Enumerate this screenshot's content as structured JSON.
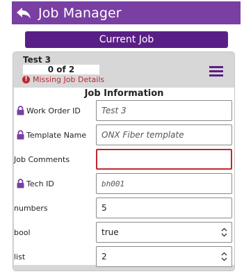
{
  "app": {
    "title": "Job Manager"
  },
  "current_job_label": "Current Job",
  "job": {
    "name": "Test 3",
    "progress": "0 of 2",
    "warning": "Missing Job Details"
  },
  "form": {
    "section_title": "Job Information",
    "fields": [
      {
        "label": "Work Order ID",
        "value": "Test 3",
        "locked": true
      },
      {
        "label": "Template Name",
        "value": "ONX Fiber template",
        "locked": true
      },
      {
        "label": "Job Comments",
        "value": "",
        "locked": false,
        "error": true
      },
      {
        "label": "Tech ID",
        "value": "bh001",
        "locked": true
      },
      {
        "label": "numbers",
        "value": "5",
        "locked": false
      },
      {
        "label": "bool",
        "value": "true",
        "locked": false,
        "type": "select"
      },
      {
        "label": "list",
        "value": "2",
        "locked": false,
        "type": "select"
      }
    ]
  },
  "colors": {
    "header": "#7a3fa2",
    "button": "#5a1f87",
    "error": "#c0272d",
    "card": "#d7d7d7"
  },
  "icons": {
    "back": "back-arrow-icon",
    "menu": "hamburger-menu-icon",
    "warning": "exclamation-circle-icon",
    "lock": "lock-icon",
    "select": "chevron-up-down-icon"
  }
}
